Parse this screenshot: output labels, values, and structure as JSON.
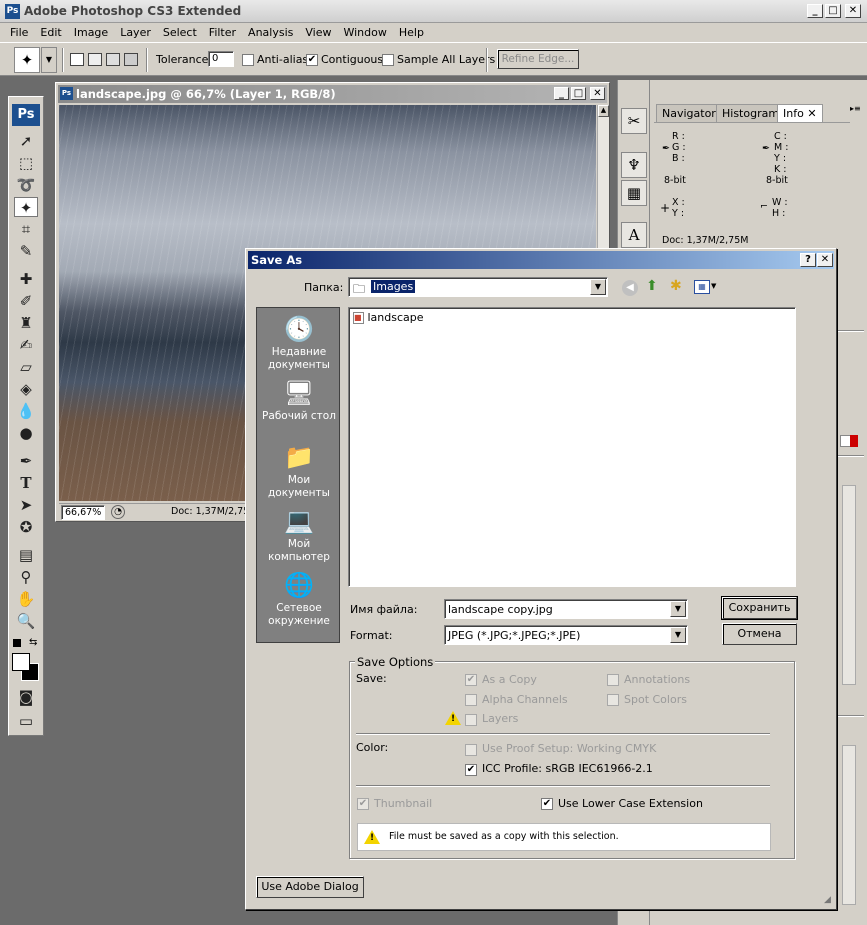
{
  "app": {
    "title": "Adobe Photoshop CS3 Extended",
    "logo": "Ps",
    "menus": [
      "File",
      "Edit",
      "Image",
      "Layer",
      "Select",
      "Filter",
      "Analysis",
      "View",
      "Window",
      "Help"
    ]
  },
  "options_bar": {
    "tolerance_label": "Tolerance:",
    "tolerance_value": "0",
    "anti_alias": "Anti-alias",
    "contiguous": "Contiguous",
    "sample_all_layers": "Sample All Layers",
    "refine_edge": "Refine Edge..."
  },
  "document": {
    "title": "landscape.jpg @ 66,7% (Layer 1, RGB/8)",
    "zoom": "66,67%",
    "doc_size": "Doc: 1,37M/2,75M"
  },
  "panels": {
    "tabs": [
      "Navigator",
      "Histogram",
      "Info"
    ],
    "active_tab": "Info",
    "info": {
      "r": "R :",
      "g": "G :",
      "b": "B :",
      "c": "C :",
      "m": "M :",
      "y": "Y :",
      "k": "K :",
      "bit_left": "8-bit",
      "bit_right": "8-bit",
      "x": "X :",
      "yy": "Y :",
      "w": "W :",
      "h": "H :",
      "doc": "Doc: 1,37M/2,75M"
    }
  },
  "dialog": {
    "title": "Save As",
    "folder_label": "Папка:",
    "folder_value": "Images",
    "file_item": "landscape",
    "places": [
      "Недавние документы",
      "Рабочий стол",
      "Мои документы",
      "Мой компьютер",
      "Сетевое окружение"
    ],
    "filename_label": "Имя файла:",
    "filename_value": "landscape copy.jpg",
    "format_label": "Format:",
    "format_value": "JPEG (*.JPG;*.JPEG;*.JPE)",
    "save_button": "Сохранить",
    "cancel_button": "Отмена",
    "save_options_title": "Save Options",
    "save_label": "Save:",
    "as_a_copy": "As a Copy",
    "annotations": "Annotations",
    "alpha_channels": "Alpha Channels",
    "spot_colors": "Spot Colors",
    "layers": "Layers",
    "color_label": "Color:",
    "use_proof_setup": "Use Proof Setup:  Working CMYK",
    "icc_profile": "ICC Profile:  sRGB IEC61966-2.1",
    "thumbnail": "Thumbnail",
    "lower_case": "Use Lower Case Extension",
    "warning": "File must be saved as a copy with this selection.",
    "adobe_dialog_button": "Use Adobe Dialog"
  }
}
